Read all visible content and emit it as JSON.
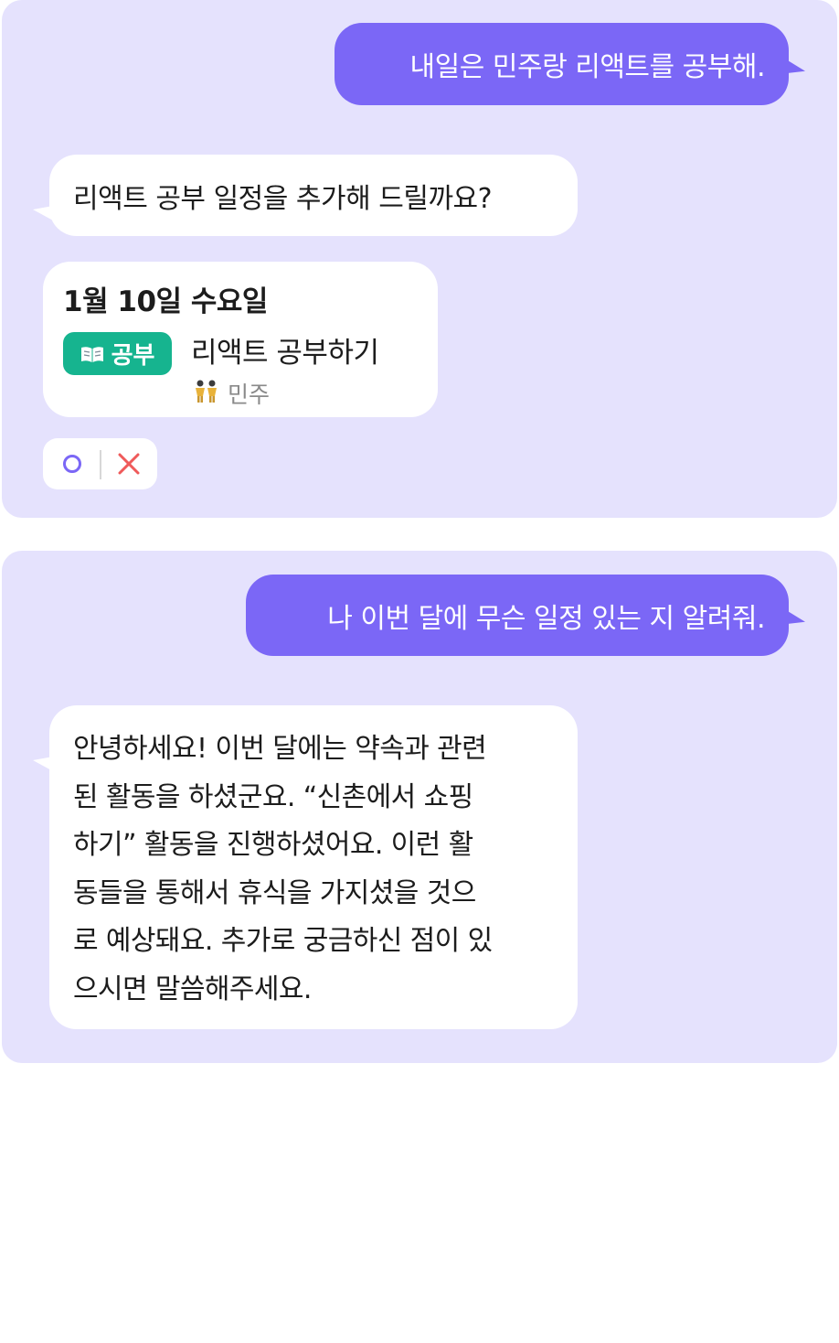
{
  "conversation1": {
    "user_message": "내일은 민주랑 리액트를 공부해.",
    "bot_message": "리액트 공부 일정을 추가해 드릴까요?",
    "event_card": {
      "date": "1월 10일 수요일",
      "tag": {
        "label": "공부",
        "icon": "book-icon",
        "color": "#16b48f"
      },
      "title": "리액트 공부하기",
      "attendee": "민주",
      "attendee_icon": "people-icon"
    },
    "confirm_actions": {
      "yes_icon": "circle-icon",
      "no_icon": "x-icon"
    }
  },
  "conversation2": {
    "user_message": "나 이번 달에 무슨 일정 있는 지 알려줘.",
    "bot_message_lines": [
      "안녕하세요! 이번 달에는 약속과 관련",
      "된 활동을 하셨군요. “신촌에서 쇼핑",
      "하기” 활동을 진행하셨어요. 이런 활",
      "동들을 통해서 휴식을 가지셨을 것으",
      "로 예상돼요. 추가로 궁금하신 점이 있",
      "으시면 말씀해주세요."
    ]
  },
  "colors": {
    "panel_bg": "#e5e2fd",
    "user_bubble": "#7b67f6",
    "bot_bubble": "#ffffff",
    "accept": "#7b67f6",
    "reject": "#ef5a5a"
  }
}
